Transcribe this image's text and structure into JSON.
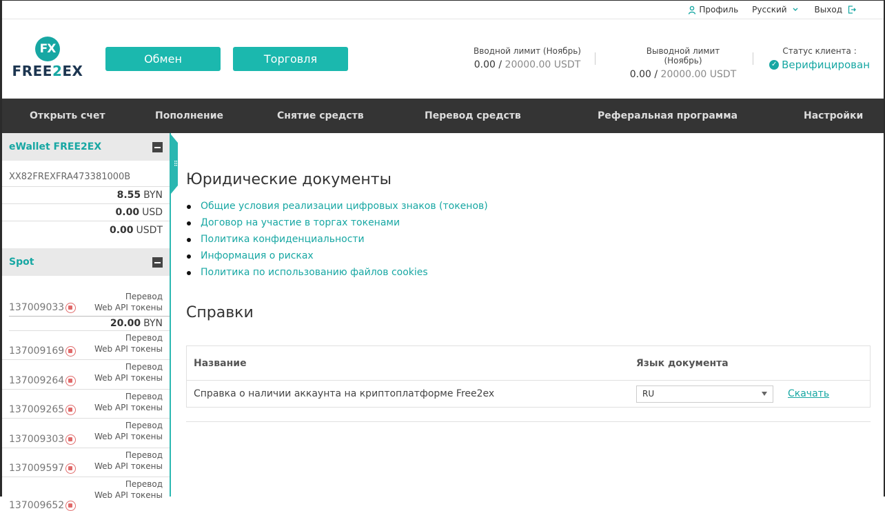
{
  "topbar": {
    "profile": "Профиль",
    "language": "Русский",
    "logout": "Выход"
  },
  "logo": {
    "mark": "FX",
    "word_a": "FREE",
    "word_b": "2",
    "word_c": "EX"
  },
  "header": {
    "exchange_btn": "Обмен",
    "trade_btn": "Торговля",
    "input_limit": {
      "label": "Вводной лимит (Ноябрь)",
      "used": "0.00",
      "sep": " / ",
      "max": "20000.00 USDT"
    },
    "output_limit": {
      "label": "Выводной лимит (Ноябрь)",
      "used": "0.00",
      "sep": " / ",
      "max": "20000.00 USDT"
    },
    "status": {
      "label": "Статус клиента :",
      "value": "Верифицирован"
    }
  },
  "nav": [
    "Открыть счет",
    "Пополнение",
    "Снятие средств",
    "Перевод средств",
    "Реферальная программа",
    "Настройки"
  ],
  "sidebar": {
    "ewallet": {
      "title": "eWallet FREE2EX",
      "account": "XX82FREXFRA473381000B",
      "balances": [
        {
          "amount": "8.55",
          "cur": "BYN"
        },
        {
          "amount": "0.00",
          "cur": "USD"
        },
        {
          "amount": "0.00",
          "cur": "USDT"
        }
      ]
    },
    "spot": {
      "title": "Spot",
      "label_line1": "Перевод",
      "label_line2": "Web API токены",
      "first_balance": {
        "amount": "20.00",
        "cur": "BYN"
      },
      "accounts": [
        "137009033",
        "137009169",
        "137009264",
        "137009265",
        "137009303",
        "137009597",
        "137009652"
      ]
    }
  },
  "main": {
    "legal_title": "Юридические документы",
    "docs": [
      "Общие условия реализации цифровых знаков (токенов)",
      "Договор на участие в торгах токенами",
      "Политика конфиденциальности",
      "Информация о рисках",
      "Политика по использованию файлов cookies"
    ],
    "refs_title": "Справки",
    "table": {
      "col_name": "Название",
      "col_lang": "Язык документа",
      "row_name": "Справка о наличии аккаунта на криптоплатформе Free2ex",
      "row_lang": "RU",
      "download": "Скачать"
    }
  },
  "colors": {
    "accent": "#17a7a3",
    "button": "#1bb8ae",
    "nav_bg": "#343434"
  }
}
